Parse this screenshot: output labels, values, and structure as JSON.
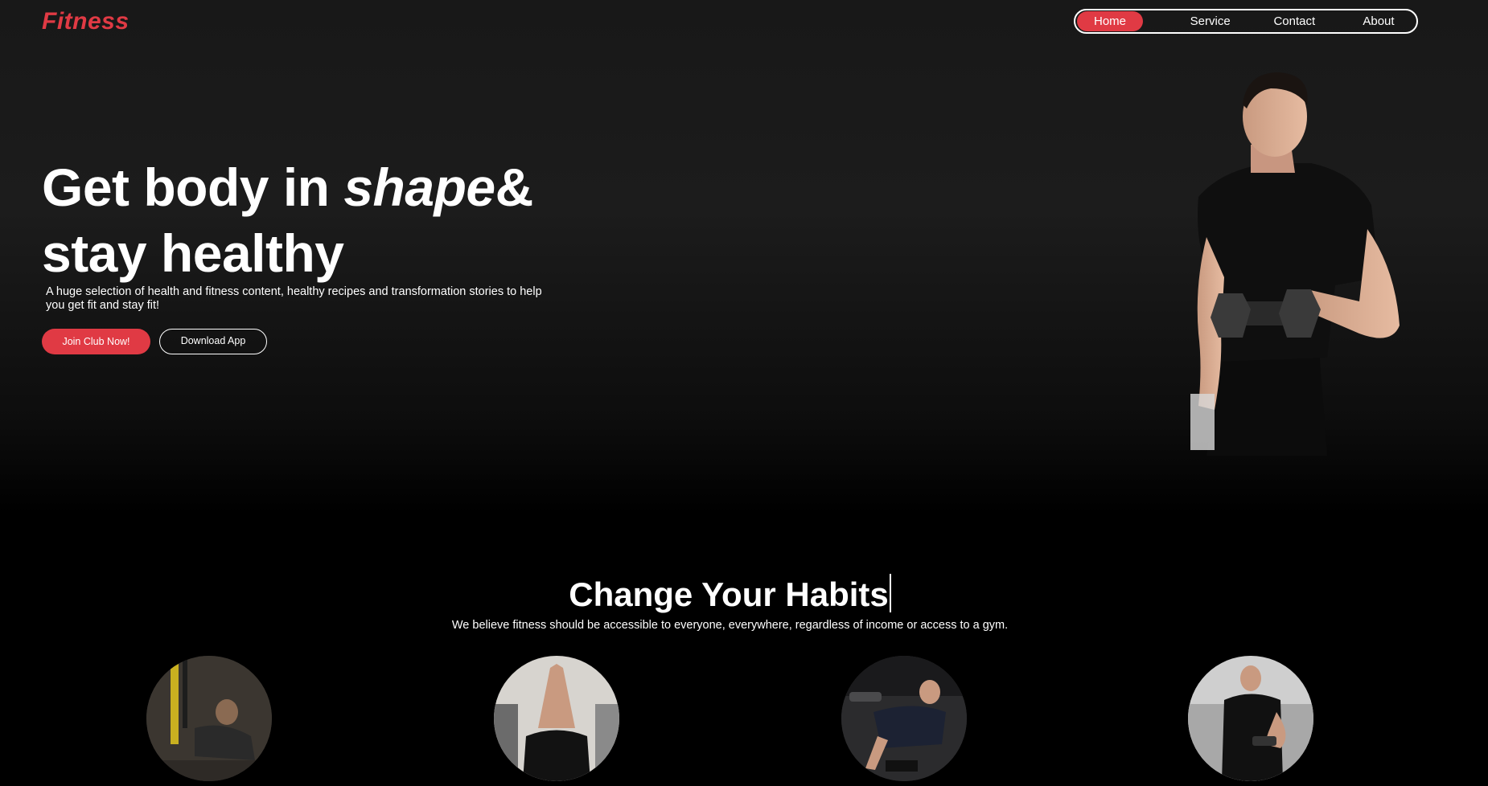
{
  "brand": {
    "name": "Fitness",
    "accent": "#e03a44"
  },
  "nav": {
    "items": [
      "Home",
      "Service",
      "Contact",
      "About"
    ],
    "active": "Home"
  },
  "hero": {
    "title_part1": "Get body in ",
    "title_italic": "shape",
    "title_part2": "&",
    "title_line2": "stay healthy",
    "description": "A huge selection of health and fitness content, healthy recipes and transformation stories to help you get fit and stay fit!",
    "primary_button": "Join Club Now!",
    "secondary_button": "Download App",
    "image_icon": "man-with-dumbbell-image"
  },
  "habits": {
    "title": "Change Your Habits",
    "description": "We believe fitness should be accessible to everyone, everywhere, regardless of income or access to a gym.",
    "images": [
      "trx-pushup-image",
      "stretching-image",
      "dumbbell-row-image",
      "bicep-curl-image"
    ]
  }
}
